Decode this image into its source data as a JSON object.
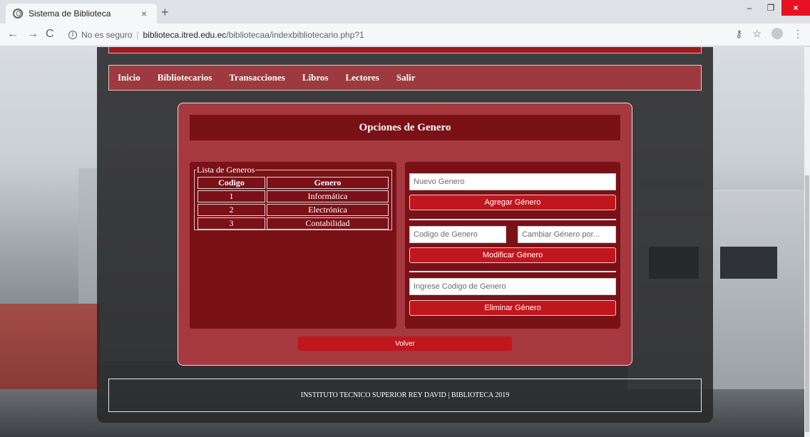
{
  "browser": {
    "tab_title": "Sistema de Biblioteca",
    "tab_close": "×",
    "new_tab": "+",
    "insecure_label": "No es seguro",
    "url_host": "biblioteca.itred.edu.ec",
    "url_path": "/bibliotecaa/indexbibliotecario.php?1",
    "win_minimize": "–",
    "win_maximize": "❐",
    "win_close": "×"
  },
  "menu": {
    "items": [
      "Inicio",
      "Bibliotecarios",
      "Transacciones",
      "Libros",
      "Lectores",
      "Salir"
    ]
  },
  "panel": {
    "title": "Opciones de Genero"
  },
  "generos": {
    "legend": "Lista de Generos",
    "headers": [
      "Codigo",
      "Genero"
    ],
    "rows": [
      {
        "codigo": "1",
        "genero": "Informática"
      },
      {
        "codigo": "2",
        "genero": "Electrónica"
      },
      {
        "codigo": "3",
        "genero": "Contabilidad"
      }
    ]
  },
  "form": {
    "nuevo_placeholder": "Nuevo Genero",
    "agregar_label": "Agregar Género",
    "codigo_placeholder": "Codigo de Genero",
    "cambiar_placeholder": "Cambiar Género por...",
    "modificar_label": "Modificar Género",
    "eliminar_placeholder": "Ingrese Codigo de Genero",
    "eliminar_label": "Eliminar Género"
  },
  "volver_label": "Volver",
  "footer_text": "INSTITUTO TECNICO SUPERIOR REY DAVID | BIBLIOTECA 2019",
  "colors": {
    "accent_red": "#c0161d",
    "dark_red": "#7a1117",
    "panel_red": "#a5393f"
  }
}
